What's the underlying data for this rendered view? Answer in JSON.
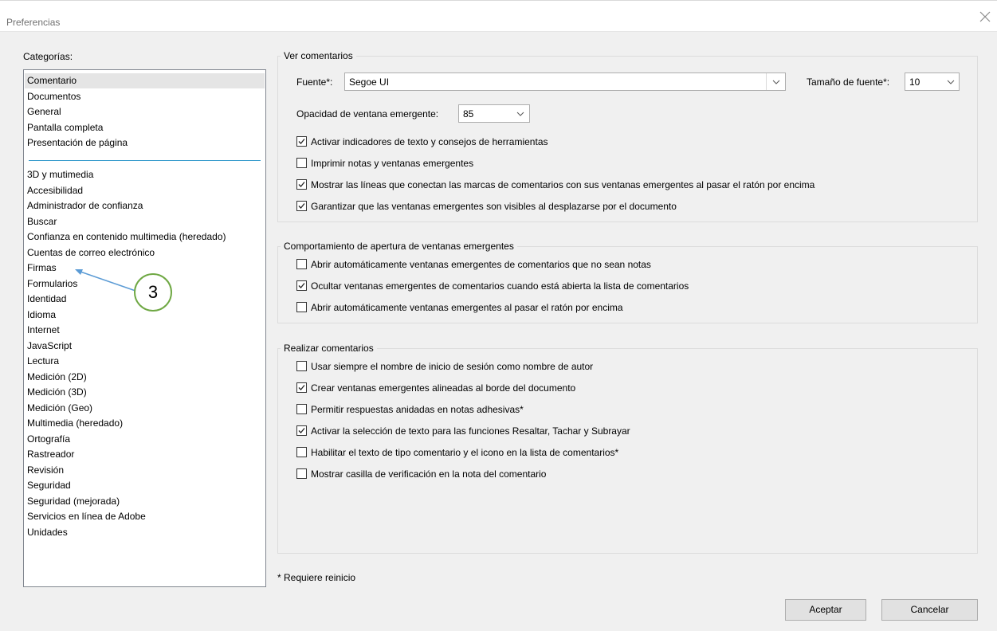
{
  "window": {
    "title": "Preferencias"
  },
  "categories": {
    "label": "Categorías:",
    "items": [
      "Comentario",
      "Documentos",
      "General",
      "Pantalla completa",
      "Presentación de página",
      "3D y mutimedia",
      "Accesibilidad",
      "Administrador de confianza",
      "Buscar",
      "Confianza en contenido multimedia (heredado)",
      "Cuentas de correo electrónico",
      "Firmas",
      "Formularios",
      "Identidad",
      "Idioma",
      "Internet",
      "JavaScript",
      "Lectura",
      "Medición (2D)",
      "Medición (3D)",
      "Medición (Geo)",
      "Multimedia (heredado)",
      "Ortografía",
      "Rastreador",
      "Revisión",
      "Seguridad",
      "Seguridad (mejorada)",
      "Servicios en línea de Adobe",
      "Unidades"
    ],
    "selected": "Comentario"
  },
  "annotation": {
    "number": "3",
    "color": "#6fa844",
    "arrow_color": "#5b9bd5"
  },
  "ver_comentarios": {
    "title": "Ver comentarios",
    "font_label": "Fuente*:",
    "font_value": "Segoe UI",
    "font_size_label": "Tamaño de fuente*:",
    "font_size_value": "10",
    "opacity_label": "Opacidad de ventana emergente:",
    "opacity_value": "85",
    "checkboxes": [
      {
        "label": "Activar indicadores de texto y consejos de herramientas",
        "checked": true
      },
      {
        "label": "Imprimir notas y ventanas emergentes",
        "checked": false
      },
      {
        "label": "Mostrar las líneas que conectan las marcas de comentarios con sus ventanas emergentes al pasar el ratón por encima",
        "checked": true
      },
      {
        "label": "Garantizar que las ventanas emergentes son visibles al desplazarse por el documento",
        "checked": true
      }
    ]
  },
  "comportamiento": {
    "title": "Comportamiento de apertura de ventanas emergentes",
    "checkboxes": [
      {
        "label": "Abrir automáticamente ventanas emergentes de comentarios que no sean notas",
        "checked": false
      },
      {
        "label": "Ocultar ventanas emergentes de comentarios cuando está abierta la lista de comentarios",
        "checked": true
      },
      {
        "label": "Abrir automáticamente ventanas emergentes al pasar el ratón por encima",
        "checked": false
      }
    ]
  },
  "realizar": {
    "title": "Realizar comentarios",
    "checkboxes": [
      {
        "label": "Usar siempre el nombre de inicio de sesión como nombre de autor",
        "checked": false
      },
      {
        "label": "Crear ventanas emergentes alineadas al borde del documento",
        "checked": true
      },
      {
        "label": "Permitir respuestas anidadas en notas adhesivas*",
        "checked": false
      },
      {
        "label": "Activar la selección de texto para las funciones Resaltar, Tachar y Subrayar",
        "checked": true
      },
      {
        "label": "Habilitar el texto de tipo comentario y el icono en la lista de comentarios*",
        "checked": false
      },
      {
        "label": "Mostrar casilla de verificación en la nota del comentario",
        "checked": false
      }
    ]
  },
  "footer": {
    "note": "* Requiere reinicio",
    "accept": "Aceptar",
    "cancel": "Cancelar"
  }
}
